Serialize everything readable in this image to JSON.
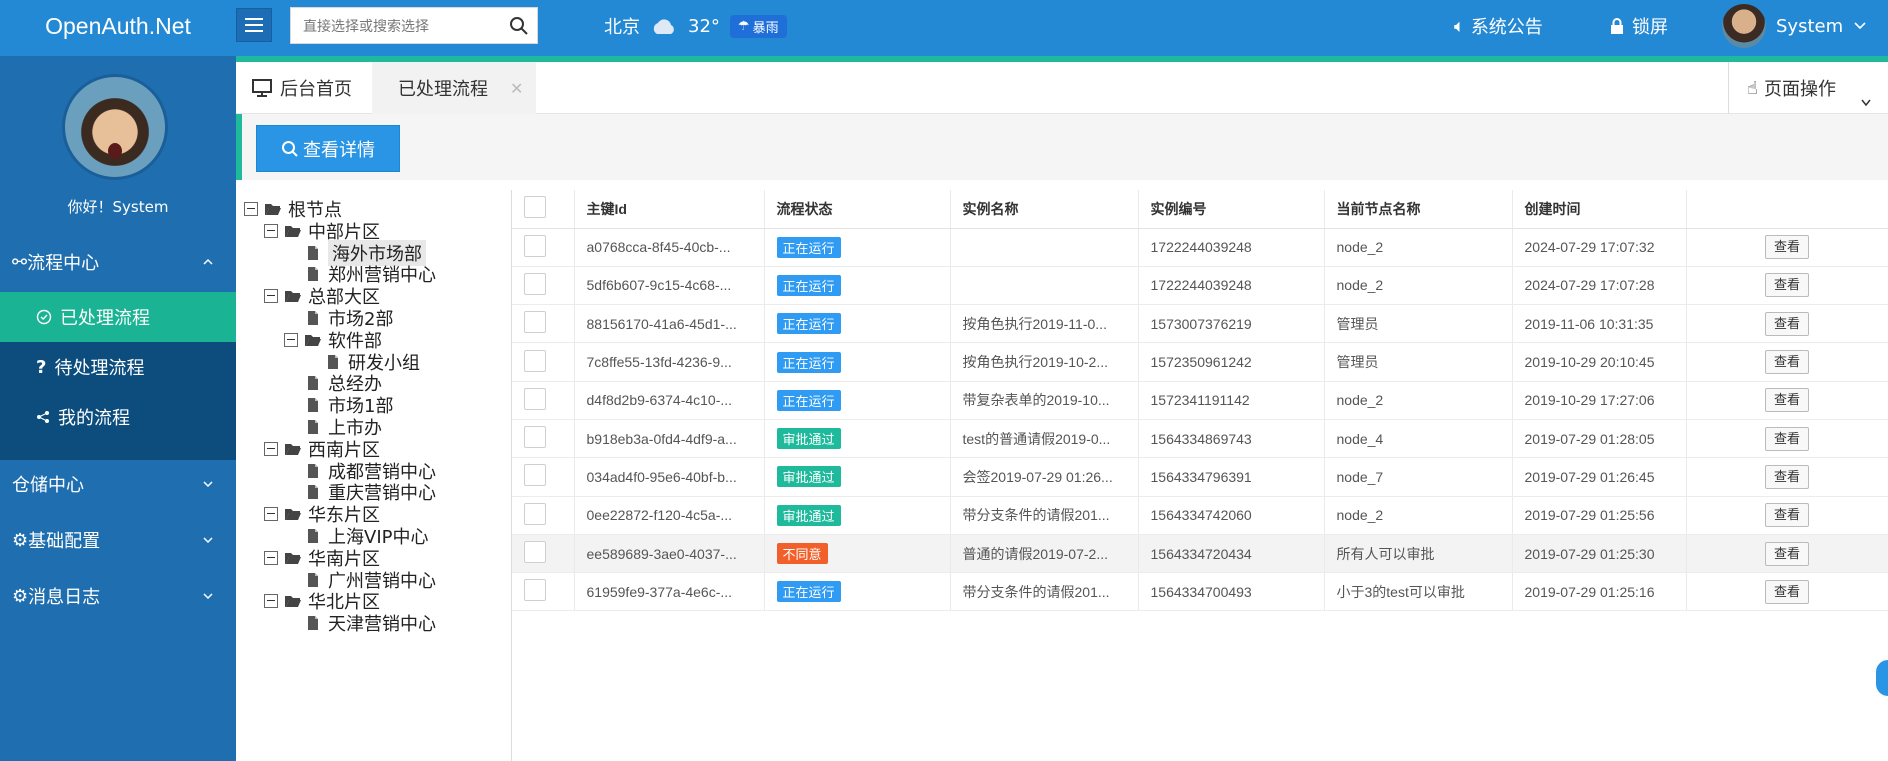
{
  "header": {
    "logo": "OpenAuth.Net",
    "search_placeholder": "直接选择或搜索选择",
    "weather": {
      "city": "北京",
      "temp": "32°",
      "condition": "暴雨"
    },
    "notice": "系统公告",
    "lock": "锁屏",
    "user": "System"
  },
  "sidebar": {
    "greeting": "你好！System",
    "groups": [
      {
        "label": "流程中心"
      },
      {
        "label": "仓储中心"
      },
      {
        "label": "基础配置"
      },
      {
        "label": "消息日志"
      }
    ],
    "sub_items": [
      {
        "label": "已处理流程"
      },
      {
        "label": "待处理流程"
      },
      {
        "label": "我的流程"
      }
    ]
  },
  "tabs": {
    "home": "后台首页",
    "active": "已处理流程",
    "page_ops": "页面操作"
  },
  "toolbar": {
    "detail_label": "查看详情"
  },
  "tree": {
    "nodes": [
      {
        "label": "根节点"
      },
      {
        "label": "中部片区"
      },
      {
        "label": "海外市场部"
      },
      {
        "label": "郑州营销中心"
      },
      {
        "label": "总部大区"
      },
      {
        "label": "市场2部"
      },
      {
        "label": "软件部"
      },
      {
        "label": "研发小组"
      },
      {
        "label": "总经办"
      },
      {
        "label": "市场1部"
      },
      {
        "label": "上市办"
      },
      {
        "label": "西南片区"
      },
      {
        "label": "成都营销中心"
      },
      {
        "label": "重庆营销中心"
      },
      {
        "label": "华东片区"
      },
      {
        "label": "上海VIP中心"
      },
      {
        "label": "华南片区"
      },
      {
        "label": "广州营销中心"
      },
      {
        "label": "华北片区"
      },
      {
        "label": "天津营销中心"
      }
    ]
  },
  "table": {
    "columns": [
      "主键Id",
      "流程状态",
      "实例名称",
      "实例编号",
      "当前节点名称",
      "创建时间"
    ],
    "view_label": "查看",
    "rows": [
      {
        "id": "a0768cca-8f45-40cb-...",
        "status": "正在运行",
        "status_type": "run",
        "name": "",
        "code": "1722244039248",
        "node": "node_2",
        "time": "2024-07-29 17:07:32"
      },
      {
        "id": "5df6b607-9c15-4c68-...",
        "status": "正在运行",
        "status_type": "run",
        "name": "",
        "code": "1722244039248",
        "node": "node_2",
        "time": "2024-07-29 17:07:28"
      },
      {
        "id": "88156170-41a6-45d1-...",
        "status": "正在运行",
        "status_type": "run",
        "name": "按角色执行2019-11-0...",
        "code": "1573007376219",
        "node": "管理员",
        "time": "2019-11-06 10:31:35"
      },
      {
        "id": "7c8ffe55-13fd-4236-9...",
        "status": "正在运行",
        "status_type": "run",
        "name": "按角色执行2019-10-2...",
        "code": "1572350961242",
        "node": "管理员",
        "time": "2019-10-29 20:10:45"
      },
      {
        "id": "d4f8d2b9-6374-4c10-...",
        "status": "正在运行",
        "status_type": "run",
        "name": "带复杂表单的2019-10...",
        "code": "1572341191142",
        "node": "node_2",
        "time": "2019-10-29 17:27:06"
      },
      {
        "id": "b918eb3a-0fd4-4df9-a...",
        "status": "审批通过",
        "status_type": "ok",
        "name": "test的普通请假2019-0...",
        "code": "1564334869743",
        "node": "node_4",
        "time": "2019-07-29 01:28:05"
      },
      {
        "id": "034ad4f0-95e6-40bf-b...",
        "status": "审批通过",
        "status_type": "ok",
        "name": "会签2019-07-29 01:26...",
        "code": "1564334796391",
        "node": "node_7",
        "time": "2019-07-29 01:26:45"
      },
      {
        "id": "0ee22872-f120-4c5a-...",
        "status": "审批通过",
        "status_type": "ok",
        "name": "带分支条件的请假201...",
        "code": "1564334742060",
        "node": "node_2",
        "time": "2019-07-29 01:25:56"
      },
      {
        "id": "ee589689-3ae0-4037-...",
        "status": "不同意",
        "status_type": "no",
        "name": "普通的请假2019-07-2...",
        "code": "1564334720434",
        "node": "所有人可以审批",
        "time": "2019-07-29 01:25:30"
      },
      {
        "id": "61959fe9-377a-4e6c-...",
        "status": "正在运行",
        "status_type": "run",
        "name": "带分支条件的请假201...",
        "code": "1564334700493",
        "node": "小于3的test可以审批",
        "time": "2019-07-29 01:25:16"
      }
    ]
  },
  "colors": {
    "header": "#2489d4",
    "accent": "#1fba9c",
    "sidebar": "#1f6fb0",
    "run": "#2f9bf3",
    "ok": "#1fba9c",
    "no": "#f1602b"
  }
}
